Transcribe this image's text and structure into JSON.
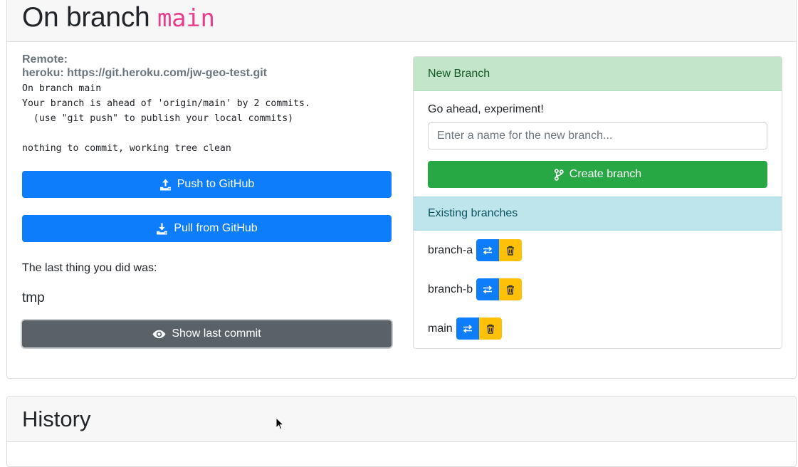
{
  "status": {
    "title_prefix": "On branch",
    "branch": "main",
    "remote_label": "Remote:",
    "remote_url": "heroku: https://git.heroku.com/jw-geo-test.git",
    "git_output": "On branch main\nYour branch is ahead of 'origin/main' by 2 commits.\n  (use \"git push\" to publish your local commits)\n\nnothing to commit, working tree clean",
    "push_label": "Push to GitHub",
    "pull_label": "Pull from GitHub",
    "last_label": "The last thing you did was:",
    "last_message": "tmp",
    "show_commit_label": "Show last commit"
  },
  "new_branch": {
    "header": "New Branch",
    "prompt": "Go ahead, experiment!",
    "placeholder": "Enter a name for the new branch...",
    "create_label": "Create branch"
  },
  "existing": {
    "header": "Existing branches",
    "branches": [
      "branch-a",
      "branch-b",
      "main"
    ]
  },
  "history": {
    "title": "History"
  },
  "colors": {
    "primary": "#0d7dfb",
    "success": "#28a745",
    "warning": "#ffc107",
    "secondary": "#5a6268",
    "code": "#e83e8c"
  },
  "icons": {
    "push": "upload-icon",
    "pull": "download-icon",
    "show": "eye-icon",
    "create": "git-branch-icon",
    "switch": "switch-arrows-icon",
    "delete": "trash-icon"
  }
}
